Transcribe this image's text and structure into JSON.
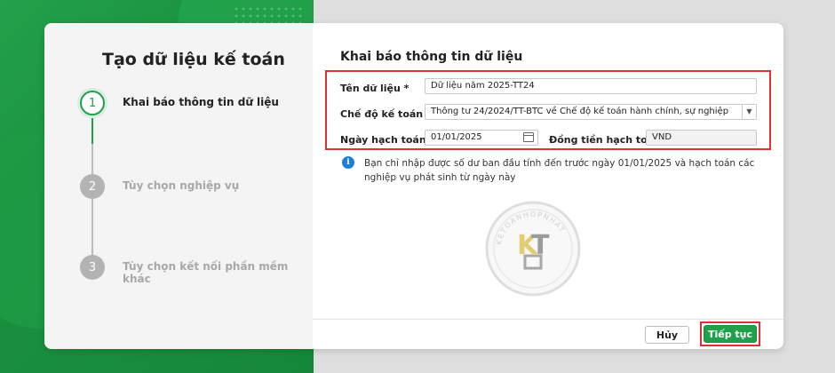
{
  "dialog": {
    "title": "Tạo dữ liệu kế toán",
    "steps": [
      {
        "number": "1",
        "label": "Khai báo thông tin dữ liệu",
        "state": "active"
      },
      {
        "number": "2",
        "label": "Tùy chọn nghiệp vụ",
        "state": "inactive"
      },
      {
        "number": "3",
        "label": "Tùy chọn kết nối phần mềm khác",
        "state": "inactive"
      }
    ]
  },
  "form": {
    "section_title": "Khai báo thông tin dữ liệu",
    "data_name_label": "Tên dữ liệu *",
    "data_name_value": "Dữ liệu năm 2025-TT24",
    "regime_label": "Chế độ kế toán",
    "regime_value": "Thông tư 24/2024/TT-BTC về Chế độ kế toán hành chính, sự nghiệp",
    "date_label": "Ngày hạch toán *",
    "date_value": "01/01/2025",
    "currency_label": "Đồng tiền hạch toán",
    "currency_value": "VND"
  },
  "info": {
    "icon": "info-icon",
    "text": "Bạn chỉ nhập được số dư ban đầu tính đến trước ngày 01/01/2025 và hạch toán các nghiệp vụ phát sinh từ ngày này"
  },
  "watermark": {
    "text": "KETOANHOPNHAT"
  },
  "buttons": {
    "cancel": "Hủy",
    "next": "Tiếp tục"
  },
  "colors": {
    "accent": "#21a04b",
    "highlight": "#e03030",
    "info": "#1f7fd6"
  }
}
